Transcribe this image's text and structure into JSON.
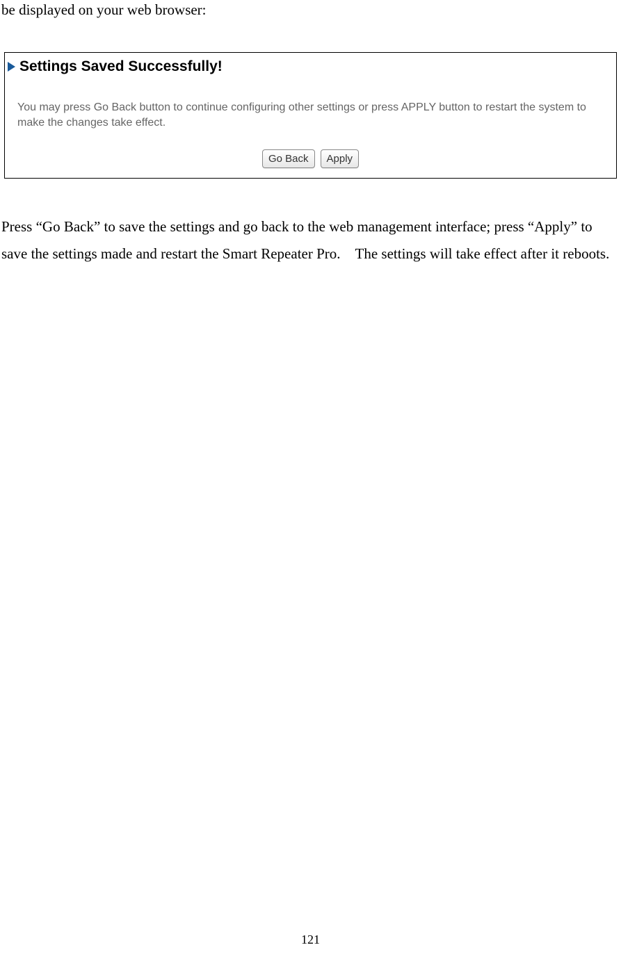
{
  "intro": "be displayed on your web browser:",
  "screenshot": {
    "title": "Settings Saved Successfully!",
    "body": "You may press Go Back button to continue configuring other settings or press APPLY button to restart the system to make the changes take effect.",
    "buttons": {
      "goBack": "Go Back",
      "apply": "Apply"
    }
  },
  "instructions": "Press “Go Back” to save the settings and go back to the web management interface; press “Apply” to save the settings made and restart the Smart Repeater Pro. The settings will take effect after it reboots.",
  "pageNumber": "121"
}
